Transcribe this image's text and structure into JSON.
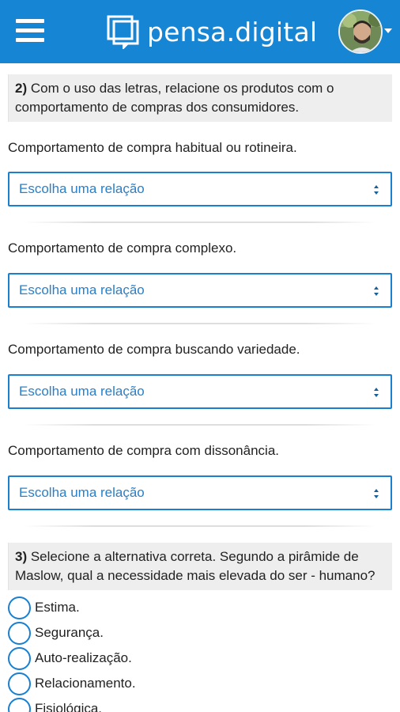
{
  "header": {
    "logo_text": "pensa.digital",
    "brand_color": "#1685d3"
  },
  "icons": {
    "menu": "hamburger-menu-icon",
    "logo": "logo-mark-icon",
    "avatar": "user-avatar",
    "dropdown": "caret-down-icon",
    "select_arrows": "up-down-arrows-icon"
  },
  "question2": {
    "number": "2)",
    "text": " Com o uso das letras, relacione os produtos com o comportamento de compras dos consumidores.",
    "items": [
      {
        "label": "Comportamento de compra habitual ou rotineira.",
        "select_value": "Escolha uma relação"
      },
      {
        "label": "Comportamento de compra complexo.",
        "select_value": "Escolha uma relação"
      },
      {
        "label": "Comportamento de compra buscando variedade.",
        "select_value": "Escolha uma relação"
      },
      {
        "label": "Comportamento de compra com dissonância.",
        "select_value": "Escolha uma relação"
      }
    ]
  },
  "question3": {
    "number": "3)",
    "text": " Selecione a alternativa correta. Segundo a pirâmide de Maslow, qual a necessidade mais elevada do ser - humano?",
    "options": [
      {
        "label": "Estima."
      },
      {
        "label": "Segurança."
      },
      {
        "label": "Auto-realização."
      },
      {
        "label": "Relacionamento."
      },
      {
        "label": "Fisiológica."
      }
    ]
  }
}
